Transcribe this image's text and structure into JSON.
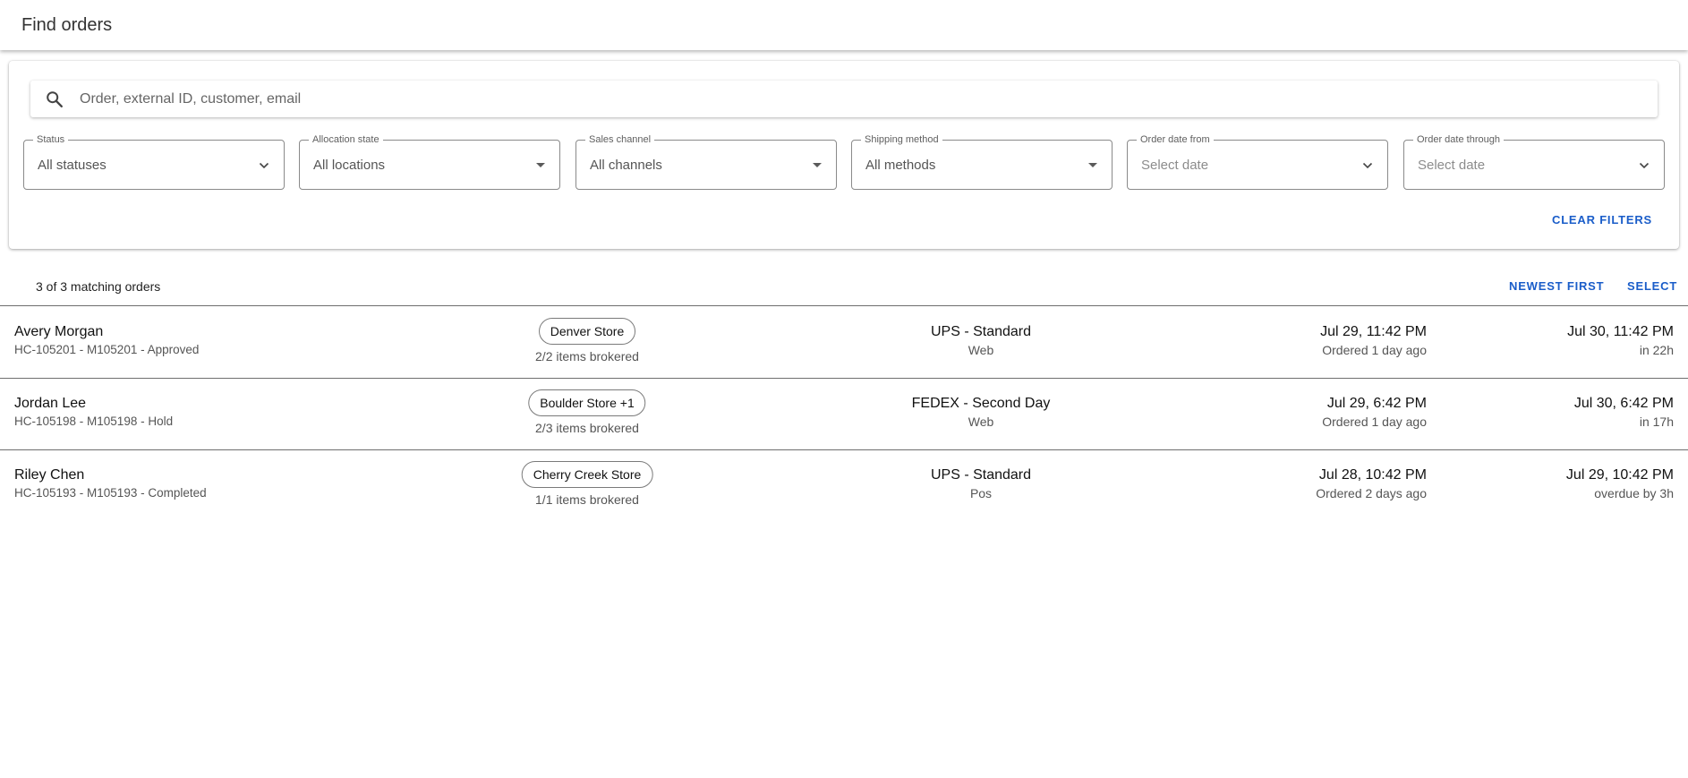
{
  "header": {
    "title": "Find orders"
  },
  "search": {
    "placeholder": "Order, external ID, customer, email",
    "value": ""
  },
  "filters": [
    {
      "label": "Status",
      "value": "All statuses",
      "control": "chevron",
      "placeholder": false
    },
    {
      "label": "Allocation state",
      "value": "All locations",
      "control": "caret",
      "placeholder": false
    },
    {
      "label": "Sales channel",
      "value": "All channels",
      "control": "caret",
      "placeholder": false
    },
    {
      "label": "Shipping method",
      "value": "All methods",
      "control": "caret",
      "placeholder": false
    },
    {
      "label": "Order date from",
      "value": "Select date",
      "control": "chevron",
      "placeholder": true
    },
    {
      "label": "Order date through",
      "value": "Select date",
      "control": "chevron",
      "placeholder": true
    }
  ],
  "clear_filters_label": "CLEAR FILTERS",
  "results": {
    "count_text": "3 of 3 matching orders",
    "sort_label": "NEWEST FIRST",
    "select_label": "SELECT"
  },
  "orders": [
    {
      "customer": "Avery Morgan",
      "meta": "HC-105201 - M105201 - Approved",
      "store": "Denver Store",
      "brokered": "2/2 items brokered",
      "shipping": "UPS - Standard",
      "channel": "Web",
      "ordered_date": "Jul 29, 11:42 PM",
      "ordered_ago": "Ordered 1 day ago",
      "due_date": "Jul 30, 11:42 PM",
      "due_status": "in 22h"
    },
    {
      "customer": "Jordan Lee",
      "meta": "HC-105198 - M105198 - Hold",
      "store": "Boulder Store +1",
      "brokered": "2/3 items brokered",
      "shipping": "FEDEX - Second Day",
      "channel": "Web",
      "ordered_date": "Jul 29, 6:42 PM",
      "ordered_ago": "Ordered 1 day ago",
      "due_date": "Jul 30, 6:42 PM",
      "due_status": "in 17h"
    },
    {
      "customer": "Riley Chen",
      "meta": "HC-105193 - M105193 - Completed",
      "store": "Cherry Creek Store",
      "brokered": "1/1 items brokered",
      "shipping": "UPS - Standard",
      "channel": "Pos",
      "ordered_date": "Jul 28, 10:42 PM",
      "ordered_ago": "Ordered 2 days ago",
      "due_date": "Jul 29, 10:42 PM",
      "due_status": "overdue by 3h"
    }
  ],
  "colors": {
    "accent": "#1a5dc9",
    "border": "#8a8a8a",
    "text": "#1f1f1f",
    "muted": "#555555"
  },
  "icons": {
    "search": "search-icon",
    "chevron": "chevron-down-icon",
    "caret": "caret-down-icon"
  }
}
